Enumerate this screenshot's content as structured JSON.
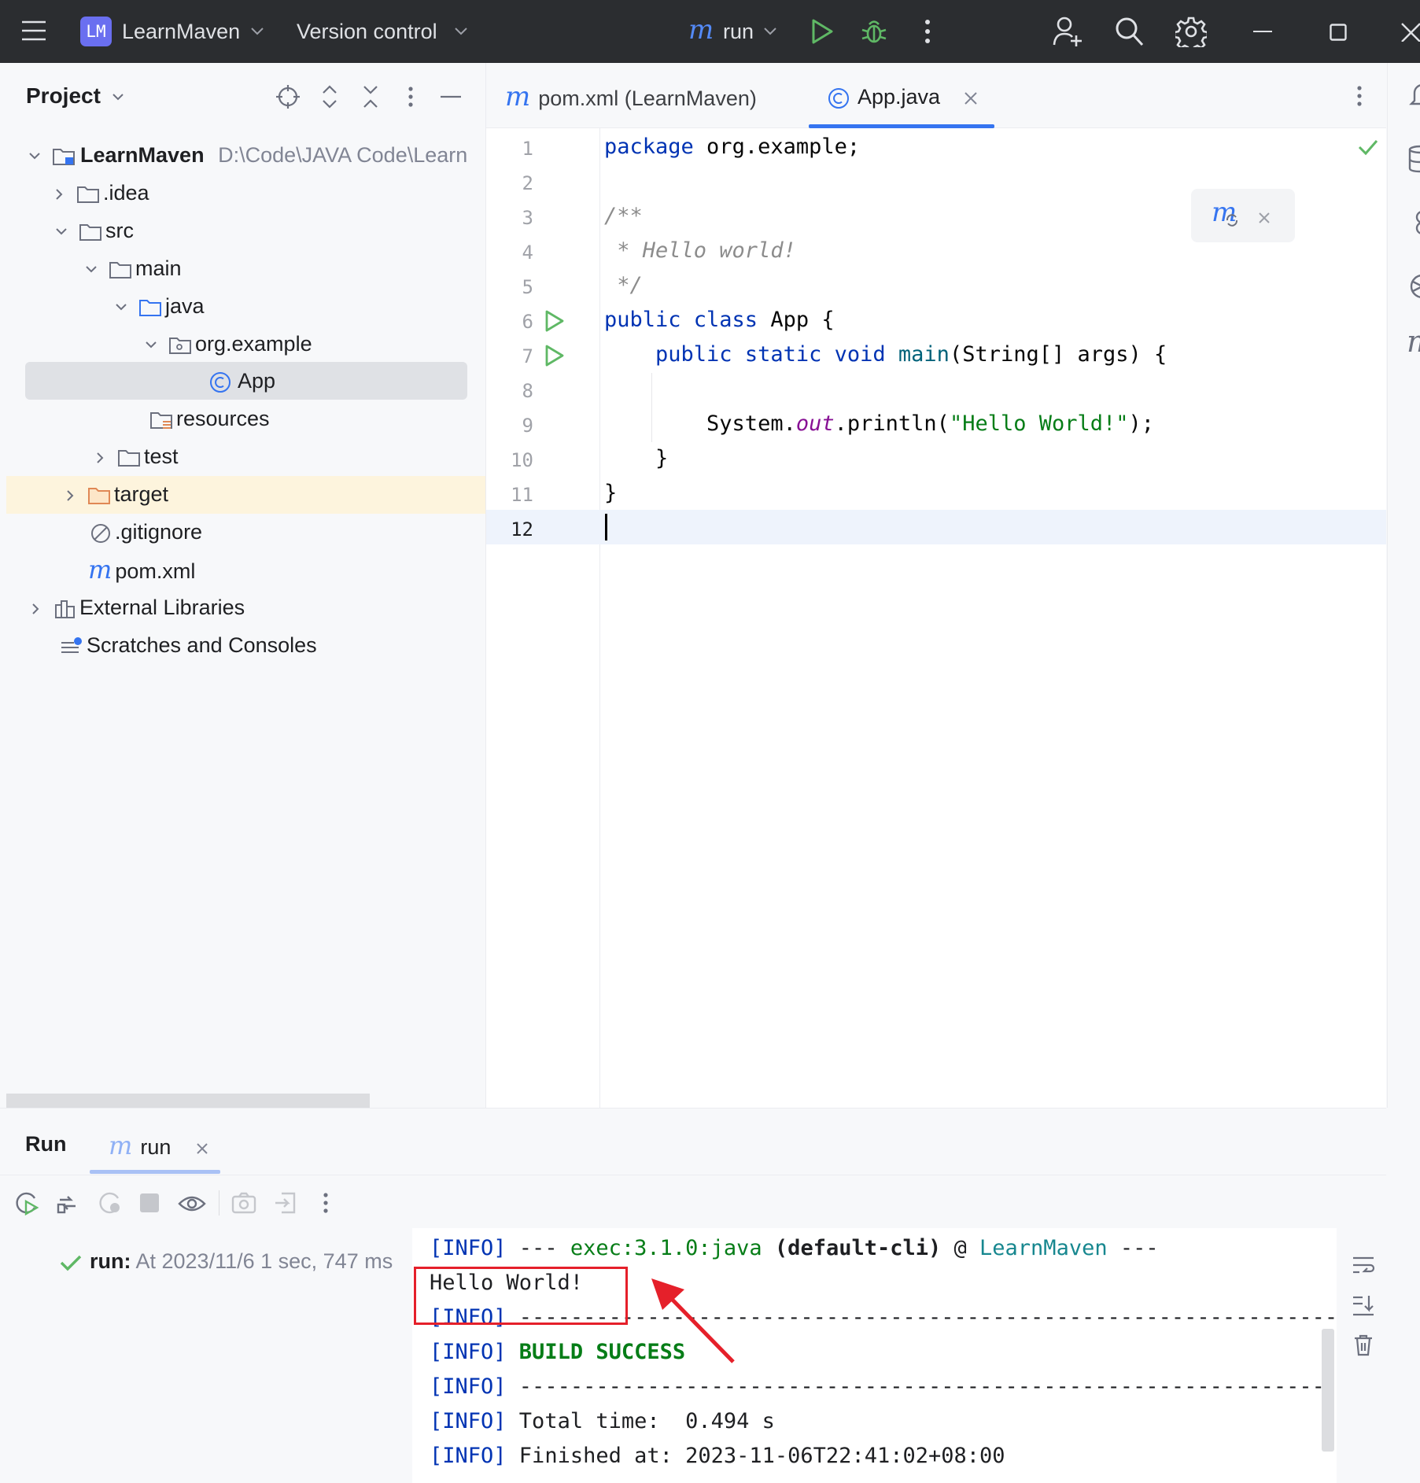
{
  "titlebar": {
    "project_badge": "LM",
    "project_name": "LearnMaven",
    "vcs_label": "Version control",
    "run_config": "run",
    "icons": [
      "hamburger-menu-icon",
      "chevron-down-icon",
      "maven-icon",
      "run-icon",
      "debug-icon",
      "more-icon",
      "add-user-icon",
      "search-icon",
      "settings-icon",
      "minimize-icon",
      "maximize-icon",
      "close-icon"
    ]
  },
  "project_panel": {
    "title": "Project",
    "tree": [
      {
        "label": "LearnMaven",
        "path": "D:\\Code\\JAVA Code\\Learn",
        "icon": "module-folder-icon"
      },
      {
        "label": ".idea",
        "icon": "folder-icon"
      },
      {
        "label": "src",
        "icon": "folder-icon"
      },
      {
        "label": "main",
        "icon": "folder-icon"
      },
      {
        "label": "java",
        "icon": "source-folder-icon"
      },
      {
        "label": "org.example",
        "icon": "package-icon"
      },
      {
        "label": "App",
        "icon": "class-icon"
      },
      {
        "label": "resources",
        "icon": "resources-folder-icon"
      },
      {
        "label": "test",
        "icon": "folder-icon"
      },
      {
        "label": "target",
        "icon": "excluded-folder-icon"
      },
      {
        "label": ".gitignore",
        "icon": "ignored-file-icon"
      },
      {
        "label": "pom.xml",
        "icon": "maven-icon"
      },
      {
        "label": "External Libraries",
        "icon": "library-icon"
      },
      {
        "label": "Scratches and Consoles",
        "icon": "scratches-icon"
      }
    ]
  },
  "editor": {
    "tabs": [
      {
        "label": "pom.xml (LearnMaven)",
        "active": false
      },
      {
        "label": "App.java",
        "active": true
      }
    ],
    "line_numbers": [
      "1",
      "2",
      "3",
      "4",
      "5",
      "6",
      "7",
      "8",
      "9",
      "10",
      "11",
      "12"
    ],
    "code": {
      "l1_kw": "package",
      "l1_rest": " org.example;",
      "l3": "/**",
      "l4": " * Hello world!",
      "l5": " */",
      "l6_kw": "public class",
      "l6_rest": " App {",
      "l7_indent": "    ",
      "l7_kw": "public static void",
      "l7_sp": " ",
      "l7_fn": "main",
      "l7_rest": "(String[] args) {",
      "l9_a": "        System.",
      "l9_fld": "out",
      "l9_b": ".println(",
      "l9_str": "\"Hello World!\"",
      "l9_c": ");",
      "l10": "    }",
      "l11": "}"
    }
  },
  "run_panel": {
    "title": "Run",
    "tab_label": "run",
    "run_entry": {
      "name": "run:",
      "detail": "At 2023/11/6 1 sec, 747 ms"
    },
    "console": {
      "tag": "[INFO]",
      "l1_dash": " --- ",
      "l1_plugin": "exec:3.1.0:java",
      "l1_exec": " (default-cli)",
      "l1_at": " @ ",
      "l1_proj": "LearnMaven",
      "l1_end": " ---",
      "l2": "Hello World!",
      "sep": " ------------------------------------------------------------------------",
      "l4_success": " BUILD SUCCESS",
      "l6": " Total time:  0.494 s",
      "l7": " Finished at: 2023-11-06T22:41:02+08:00"
    }
  },
  "colors": {
    "titlebar_bg": "#2b2d30",
    "accent_blue": "#3574f0",
    "run_green": "#5fb865",
    "annotation_red": "#e5202a"
  }
}
